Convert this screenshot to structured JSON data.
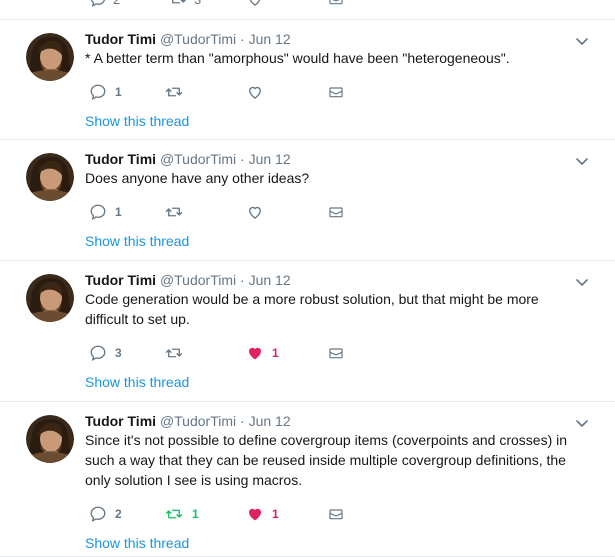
{
  "top_stub": {
    "reply_count": "2",
    "retweet_count": "3"
  },
  "tweets": [
    {
      "display_name": "Tudor Timi",
      "handle": "@TudorTimi",
      "date": "Jun 12",
      "text": "* A better term than \"amorphous\" would have been \"heterogeneous\".",
      "reply_count": "1",
      "retweet_count": "",
      "like_count": "",
      "liked": false,
      "retweeted": false,
      "show_thread": "Show this thread"
    },
    {
      "display_name": "Tudor Timi",
      "handle": "@TudorTimi",
      "date": "Jun 12",
      "text": "Does anyone have any other ideas?",
      "reply_count": "1",
      "retweet_count": "",
      "like_count": "",
      "liked": false,
      "retweeted": false,
      "show_thread": "Show this thread"
    },
    {
      "display_name": "Tudor Timi",
      "handle": "@TudorTimi",
      "date": "Jun 12",
      "text": "Code generation would be a more robust solution, but that might be more difficult to set up.",
      "reply_count": "3",
      "retweet_count": "",
      "like_count": "1",
      "liked": true,
      "retweeted": false,
      "show_thread": "Show this thread"
    },
    {
      "display_name": "Tudor Timi",
      "handle": "@TudorTimi",
      "date": "Jun 12",
      "text": "Since it's not possible to define covergroup items (coverpoints and crosses) in such a way that they can be reused inside multiple covergroup definitions, the only solution I see is using macros.",
      "reply_count": "2",
      "retweet_count": "1",
      "like_count": "1",
      "liked": true,
      "retweeted": true,
      "show_thread": "Show this thread"
    }
  ],
  "colors": {
    "link": "#1b95e0",
    "muted": "#657786",
    "like": "#e0245e",
    "retweet": "#17bf63",
    "divider": "#e6ecf0"
  },
  "icons": [
    "avatar",
    "chevron-down-icon",
    "reply-icon",
    "retweet-icon",
    "like-icon",
    "message-icon"
  ]
}
